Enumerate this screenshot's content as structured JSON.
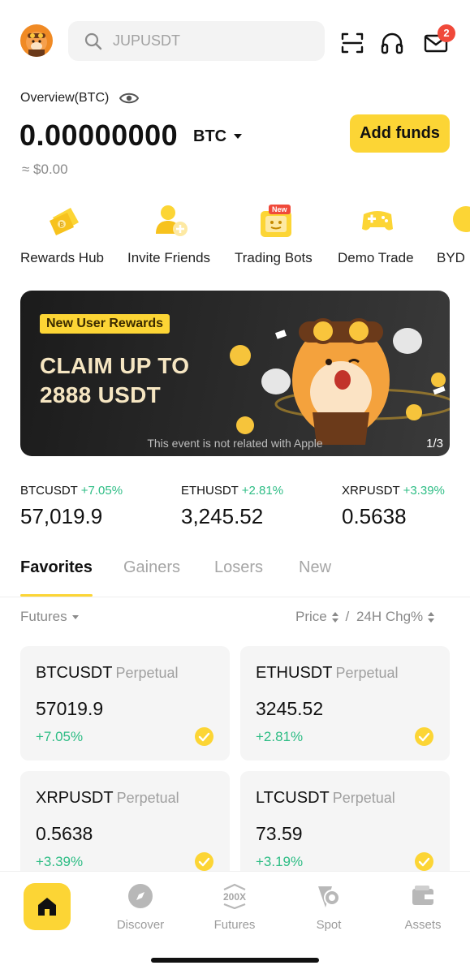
{
  "header": {
    "search_placeholder": "JUPUSDT",
    "notifications_count": "2",
    "icons": [
      "avatar",
      "search-icon",
      "scan-icon",
      "headset-icon",
      "mail-icon"
    ]
  },
  "overview": {
    "label": "Overview(BTC)",
    "balance": "0.00000000",
    "unit": "BTC",
    "fiat": "≈ $0.00",
    "add_funds_label": "Add funds"
  },
  "shortcuts": [
    {
      "label": "Rewards Hub",
      "icon": "rewards-ticket-icon"
    },
    {
      "label": "Invite Friends",
      "icon": "invite-friends-icon"
    },
    {
      "label": "Trading Bots",
      "icon": "trading-bot-icon",
      "tag": "New"
    },
    {
      "label": "Demo Trade",
      "icon": "gamepad-icon"
    },
    {
      "label": "BYD E",
      "icon": "byd-icon"
    }
  ],
  "banner": {
    "tag": "New User Rewards",
    "headline_line1": "CLAIM UP TO",
    "headline_line2": "2888 USDT",
    "disclaimer": "This event is not related with Apple",
    "pager": "1/3"
  },
  "tickers": [
    {
      "pair": "BTCUSDT",
      "change": "+7.05%",
      "price": "57,019.9"
    },
    {
      "pair": "ETHUSDT",
      "change": "+2.81%",
      "price": "3,245.52"
    },
    {
      "pair": "XRPUSDT",
      "change": "+3.39%",
      "price": "0.5638"
    }
  ],
  "tabs": [
    "Favorites",
    "Gainers",
    "Losers",
    "New"
  ],
  "filter": {
    "market": "Futures",
    "price_label": "Price",
    "separator": "/",
    "change_label": "24H Chg%"
  },
  "cards": [
    {
      "symbol": "BTCUSDT",
      "type": "Perpetual",
      "price": "57019.9",
      "change": "+7.05%"
    },
    {
      "symbol": "ETHUSDT",
      "type": "Perpetual",
      "price": "3245.52",
      "change": "+2.81%"
    },
    {
      "symbol": "XRPUSDT",
      "type": "Perpetual",
      "price": "0.5638",
      "change": "+3.39%"
    },
    {
      "symbol": "LTCUSDT",
      "type": "Perpetual",
      "price": "73.59",
      "change": "+3.19%"
    }
  ],
  "bottom_nav": [
    {
      "label": "Home",
      "icon": "home-icon"
    },
    {
      "label": "Discover",
      "icon": "compass-icon"
    },
    {
      "label": "Futures",
      "icon": "futures-200x-icon",
      "icon_text": "200X"
    },
    {
      "label": "Spot",
      "icon": "spot-icon"
    },
    {
      "label": "Assets",
      "icon": "wallet-icon"
    }
  ],
  "colors": {
    "accent": "#fcd535",
    "positive": "#2ebd85",
    "badge": "#f0493a"
  }
}
